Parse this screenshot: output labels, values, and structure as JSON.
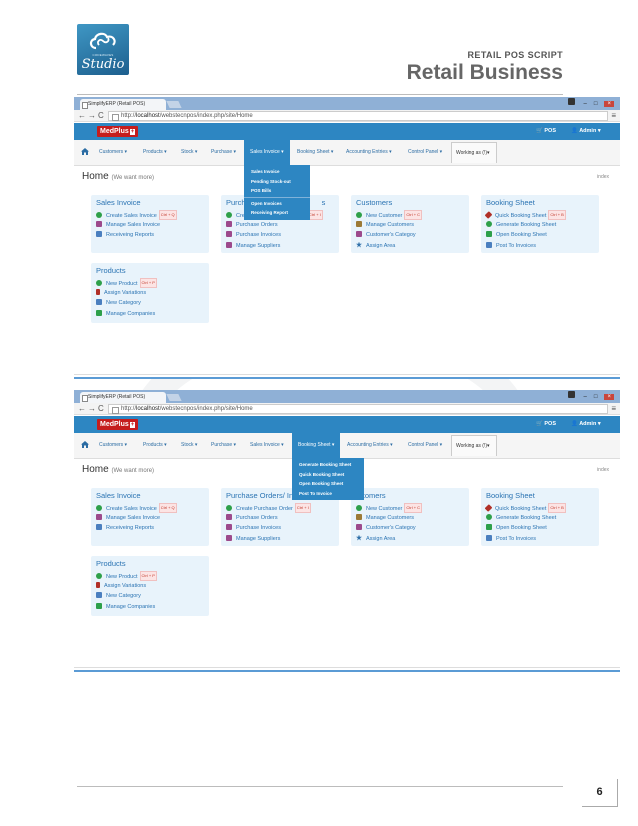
{
  "header": {
    "logo_top_text": "CODEWAVES",
    "logo_bottom_text": "Studio",
    "subtitle": "RETAIL POS SCRIPT",
    "title": "Retail Business"
  },
  "page_number": "6",
  "browser": {
    "tab_title": "SimplifyERP (Retail POS)",
    "url_prefix": "http://",
    "url_host": "localhost",
    "url_path": "/webstecnpos/index.php/site/Home",
    "back": "←",
    "forward": "→",
    "reload": "C",
    "menu": "≡"
  },
  "app": {
    "brand": "MedPlus",
    "brand_badge": "+",
    "pos_label": "POS",
    "admin_label": "Admin ▾",
    "menu_items": [
      "Customers ▾",
      "Products ▾",
      "Stock ▾",
      "Purchase ▾",
      "Sales Invoice ▾",
      "Booking Sheet ▾",
      "Accounting Entries ▾",
      "Control Panel ▾"
    ],
    "working_as": "Working as (!)▾",
    "page_title": "Home",
    "page_subtitle": "(We want more)",
    "breadcrumb": "index"
  },
  "panels": {
    "sales_invoice": {
      "title": "Sales Invoice",
      "create": "Create Sales Invoice",
      "create_kbd": "Ctrl + Q",
      "manage": "Manage Sales Invoice",
      "receiving": "Receiveing Reports"
    },
    "purchase": {
      "title": "Purchase Orders/ Invoices",
      "title_partial_1": "Purch",
      "title_partial_2": "s",
      "create": "Create Purchase Order",
      "create_partial": "Cre",
      "create_kbd": "Ctrl + I",
      "orders": "Purchase Orders",
      "invoices": "Purchase Invoices",
      "suppliers": "Manage Suppliers"
    },
    "customers": {
      "title": "Customers",
      "title_partial": "stomers",
      "create": "New Customer",
      "create_kbd": "Ctrl + C",
      "manage": "Manage Customers",
      "category": "Customer's Categoy",
      "assign": "Assign Area"
    },
    "booking": {
      "title": "Booking Sheet",
      "quick": "Quick Booking Sheet",
      "quick_kbd": "Ctrl + B",
      "generate": "Generate Booking Sheet",
      "open": "Open Booking Sheet",
      "post": "Post To Invoices"
    },
    "products": {
      "title": "Products",
      "create": "New Product",
      "create_kbd": "Ctrl + P",
      "variations": "Assign Variations",
      "category": "New Category",
      "companies": "Manage Companies"
    }
  },
  "dropdown_sales": [
    "Sales Invoice",
    "Pending Stock-out",
    "POS Bills",
    "Open Invoices",
    "Receiving Report"
  ],
  "dropdown_booking": [
    "Generate Booking Sheet",
    "Quick Booking Sheet",
    "Open Booking Sheet",
    "Post To Invoice"
  ],
  "colors": {
    "nav_blue": "#2d86c2",
    "brand_red": "#c51d1d",
    "panel_bg": "#e8f3fb",
    "link": "#2b74b3"
  }
}
